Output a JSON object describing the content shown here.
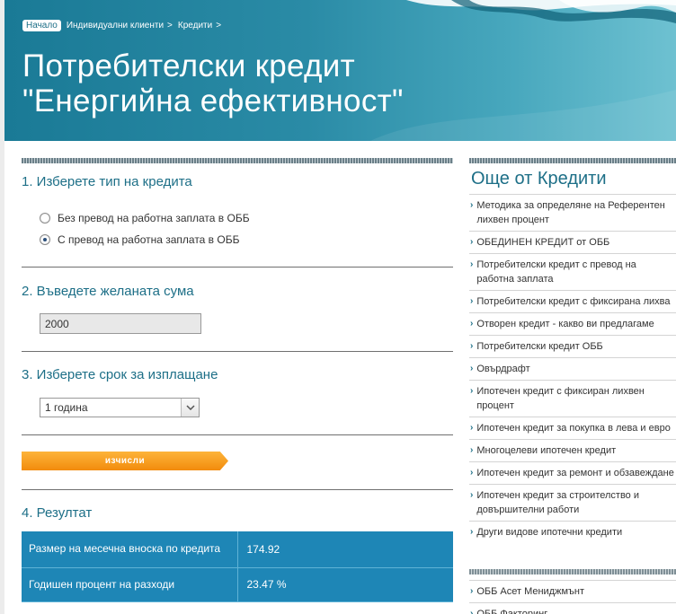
{
  "breadcrumb": {
    "home": "Начало",
    "items": [
      "Индивидуални клиенти",
      "Кредити"
    ],
    "separator": ">"
  },
  "hero": {
    "title_line1": "Потребителски кредит",
    "title_line2": "\"Енергийна ефективност\""
  },
  "form": {
    "step1": {
      "title": "1. Изберете тип на кредита",
      "options": [
        "Без превод на работна заплата в ОББ",
        "С превод на работна заплата в ОББ"
      ],
      "selected_index": 1
    },
    "step2": {
      "title": "2. Въведете желаната сума",
      "amount_value": "2000"
    },
    "step3": {
      "title": "3. Изберете срок за изплащане",
      "term_value": "1 година"
    },
    "calculate_label": "изчисли",
    "step4": {
      "title": "4. Резултат"
    },
    "result": {
      "rows": [
        {
          "label": "Размер на месечна вноска по кредита",
          "value": "174.92"
        },
        {
          "label": "Годишен процент на разходи",
          "value": "23.47 %"
        }
      ]
    }
  },
  "sidebar": {
    "title": "Още от Кредити",
    "items": [
      "Методика за определяне на Референтен лихвен процент",
      "ОБЕДИНЕН КРЕДИТ от ОББ",
      "Потребителски кредит с превод на работна заплата",
      "Потребителски кредит с фиксирана лихва",
      "Отворен кредит - какво ви предлагаме",
      "Потребителски кредит ОББ",
      "Овърдрафт",
      "Ипотечен кредит с фиксиран лихвен процент",
      "Ипотечен кредит за покупка в лева и евро",
      "Многоцелеви ипотечен кредит",
      "Ипотечен кредит за ремонт и обзавеждане",
      "Ипотечен кредит за строителство и довършителни работи",
      "Други видове ипотечни кредити"
    ],
    "items2": [
      "ОББ Асет Мениджмънт",
      "ОББ Факторинг"
    ]
  },
  "colors": {
    "hero": "#2a8ba6",
    "accent_text": "#1d6f87",
    "button": "#f5950f",
    "result_bg": "#1e86b6"
  }
}
